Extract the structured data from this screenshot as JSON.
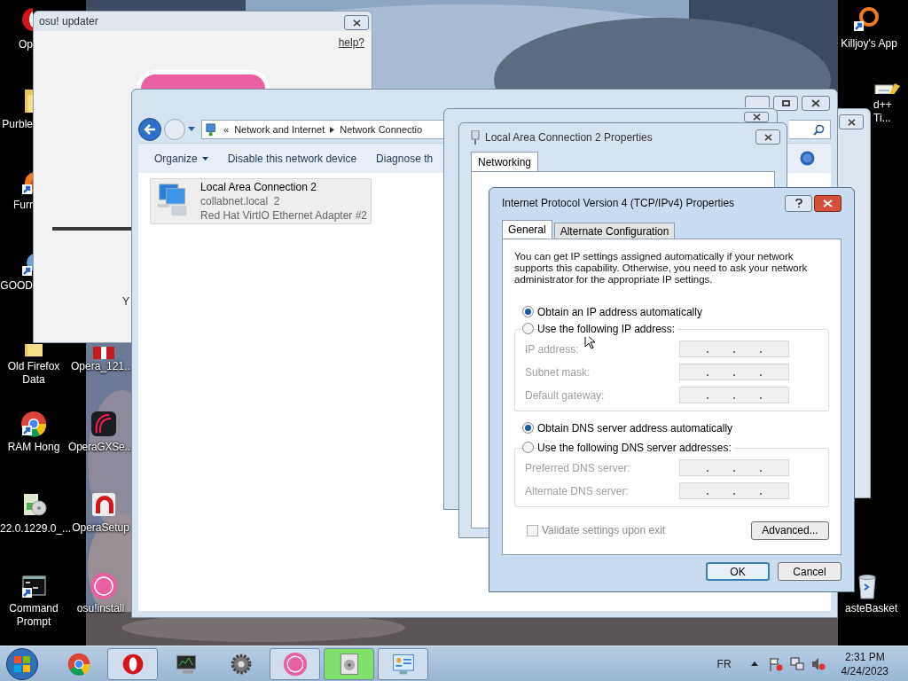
{
  "desktop_icons": [
    {
      "label": "Op",
      "kind": "opera"
    },
    {
      "label": "Purble",
      "kind": "folder"
    },
    {
      "label": "Furr",
      "kind": "firefox"
    },
    {
      "label": "GOOD",
      "kind": "app"
    },
    {
      "label": "Old Firefox Data",
      "kind": "folder"
    },
    {
      "label": "RAM Hong",
      "kind": "chrome"
    },
    {
      "label": "22.0.1229.0_...",
      "kind": "installer"
    },
    {
      "label": "Command Prompt",
      "kind": "cmd"
    },
    {
      "label": "Opera_121...",
      "kind": "gift"
    },
    {
      "label": "OperaGXSe...",
      "kind": "operagx"
    },
    {
      "label": "OperaSetup",
      "kind": "opera_setup"
    },
    {
      "label": "osu!install",
      "kind": "osu"
    },
    {
      "label": "Killjoy's App",
      "kind": "ring"
    },
    {
      "label": "d++ Ti...",
      "kind": "notepad"
    },
    {
      "label": "asteBasket",
      "kind": "recycle"
    }
  ],
  "osu_updater": {
    "title": "osu! updater",
    "help_link": "help?",
    "status_text": "Y"
  },
  "explorer": {
    "breadcrumb_prefix": "«",
    "breadcrumbs": [
      "Network and Internet",
      "Network Connectio"
    ],
    "toolbar": [
      {
        "label": "Organize",
        "menu": true
      },
      {
        "label": "Disable this network device",
        "menu": false
      },
      {
        "label": "Diagnose th",
        "menu": false
      }
    ],
    "connection": {
      "name": "Local Area Connection 2",
      "network": "collabnet.local  2",
      "adapter": "Red Hat VirtIO Ethernet Adapter #2"
    }
  },
  "properties_window": {
    "title": "Local Area Connection 2 Properties",
    "tabs": [
      {
        "label": "Networking",
        "selected": true
      }
    ]
  },
  "ipv4_dialog": {
    "title": "Internet Protocol Version 4 (TCP/IPv4) Properties",
    "tabs": [
      {
        "label": "General",
        "selected": true
      },
      {
        "label": "Alternate Configuration",
        "selected": false
      }
    ],
    "description": "You can get IP settings assigned automatically if your network supports this capability. Otherwise, you need to ask your network administrator for the appropriate IP settings.",
    "ip_options": [
      {
        "label": "Obtain an IP address automatically",
        "selected": true
      },
      {
        "label": "Use the following IP address:",
        "selected": false
      }
    ],
    "ip_fields": [
      {
        "label": "IP address:",
        "disabled": true
      },
      {
        "label": "Subnet mask:",
        "disabled": true
      },
      {
        "label": "Default gateway:",
        "disabled": true
      }
    ],
    "dns_options": [
      {
        "label": "Obtain DNS server address automatically",
        "selected": true
      },
      {
        "label": "Use the following DNS server addresses:",
        "selected": false
      }
    ],
    "dns_fields": [
      {
        "label": "Preferred DNS server:",
        "disabled": true
      },
      {
        "label": "Alternate DNS server:",
        "disabled": true
      }
    ],
    "validate": {
      "label": "Validate settings upon exit",
      "checked": false,
      "disabled": true
    },
    "advanced_button": "Advanced...",
    "buttons": [
      {
        "label": "OK",
        "default": true
      },
      {
        "label": "Cancel",
        "default": false
      }
    ]
  },
  "taskbar": {
    "items": [
      {
        "kind": "chrome",
        "running": false,
        "highlighted": false
      },
      {
        "kind": "opera",
        "running": true,
        "highlighted": false
      },
      {
        "kind": "monitor",
        "running": false,
        "highlighted": false
      },
      {
        "kind": "gear",
        "running": false,
        "highlighted": false
      },
      {
        "kind": "osu",
        "running": true,
        "highlighted": false
      },
      {
        "kind": "viewer",
        "running": true,
        "highlighted": true
      },
      {
        "kind": "control_panel",
        "running": true,
        "highlighted": false
      }
    ],
    "language": "FR",
    "time": "2:31 PM",
    "date": "4/24/2023"
  }
}
